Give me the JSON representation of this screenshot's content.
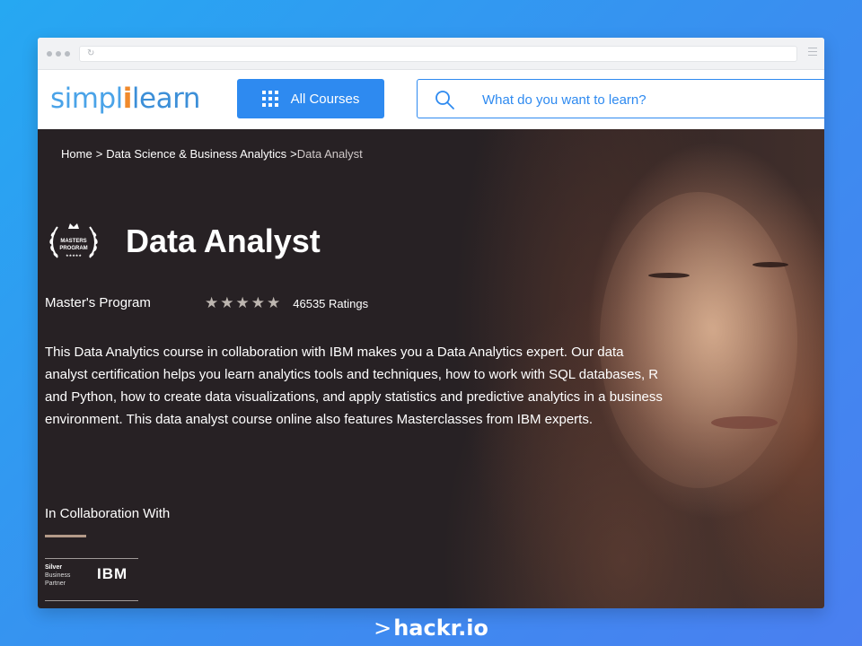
{
  "site": {
    "logo_main": "simpl",
    "logo_sep": "i",
    "logo_rest": "learn"
  },
  "header": {
    "all_courses_label": "All Courses",
    "search_placeholder": "What do you want to learn?"
  },
  "breadcrumb": {
    "items": [
      "Home",
      "Data Science & Business Analytics"
    ],
    "current": "Data Analyst",
    "separator": ">"
  },
  "course": {
    "badge_text": "MASTERS PROGRAM",
    "title": "Data Analyst",
    "program_type": "Master's Program",
    "rating_stars": 5,
    "ratings_count": "46535 Ratings",
    "description": "This Data Analytics course in collaboration with IBM makes you a Data Analytics expert. Our data analyst certification helps you learn analytics tools and techniques, how to work with SQL databases, R and Python, how to create data visualizations, and apply statistics and predictive analytics in a business environment. This data analyst course online also features Masterclasses from IBM experts."
  },
  "collaboration": {
    "label": "In Collaboration With",
    "partner_level": "Silver",
    "partner_line2": "Business",
    "partner_line3": "Partner",
    "partner_name": "IBM"
  },
  "watermark": {
    "prompt": ">",
    "text": "hackr.io"
  },
  "colors": {
    "background": "#2f9af2",
    "accent": "#2e8af0",
    "logo_orange": "#f08a2c",
    "hero_bg": "#272124"
  },
  "icons": [
    "reload-icon",
    "menu-icon",
    "grid-icon",
    "search-icon",
    "laurel-badge-icon",
    "star-icon"
  ]
}
